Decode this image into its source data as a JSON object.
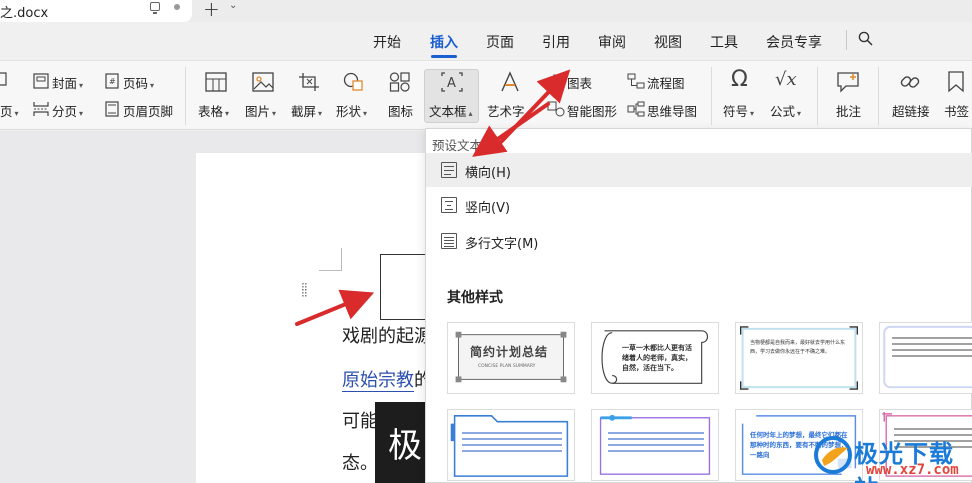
{
  "titlebar": {
    "doc_title": "之.docx"
  },
  "menu": [
    {
      "id": "menu-home",
      "label": "开始"
    },
    {
      "id": "menu-insert",
      "label": "插入"
    },
    {
      "id": "menu-page",
      "label": "页面"
    },
    {
      "id": "menu-ref",
      "label": "引用"
    },
    {
      "id": "menu-review",
      "label": "审阅"
    },
    {
      "id": "menu-view",
      "label": "视图"
    },
    {
      "id": "menu-tools",
      "label": "工具"
    },
    {
      "id": "menu-member",
      "label": "会员专享"
    }
  ],
  "ribbon": {
    "cover": "封面",
    "page_break_partial": "页",
    "section_break": "分页",
    "page_number": "页码",
    "header_footer": "页眉页脚",
    "table": "表格",
    "picture": "图片",
    "screenshot": "截屏",
    "shape": "形状",
    "icon": "图标",
    "textbox": "文本框",
    "wordart": "艺术字",
    "chart": "图表",
    "smartart": "智能图形",
    "flowchart": "流程图",
    "mindmap": "思维导图",
    "symbol": "符号",
    "formula": "公式",
    "comment": "批注",
    "hyperlink": "超链接",
    "bookmark": "书签"
  },
  "document": {
    "line1": "戏剧的起源",
    "line2_link": "原始宗教",
    "line2_rest": "的",
    "line3": "可能",
    "line4": "态。",
    "dark_char": "极"
  },
  "dropdown": {
    "section_label": "预设文本框",
    "items": [
      {
        "label": "横向(H)"
      },
      {
        "label": "竖向(V)"
      },
      {
        "label": "多行文字(M)"
      }
    ],
    "other_title": "其他样式",
    "thumbs": {
      "t1_title": "简约计划总结",
      "t1_sub": "CONCISE PLAN SUMMARY",
      "t2_text": "一草一木都比人更有活绪着人的老师，真实，自然，活在当下。",
      "t3_text": "当物梗都是自我而来，最好就去学用什么东西，学习去做你永远在于不确之难。",
      "t7_text": "任何时年上的梦想，最终它们都在那种时的东西，要有不断的梦想，一路向"
    }
  },
  "watermark": {
    "brand": "极光下载站",
    "url": "www.xz7.com"
  },
  "colors": {
    "accent": "#1a5fd0",
    "arrow": "#d92b2b",
    "link": "#2d4fb0"
  }
}
